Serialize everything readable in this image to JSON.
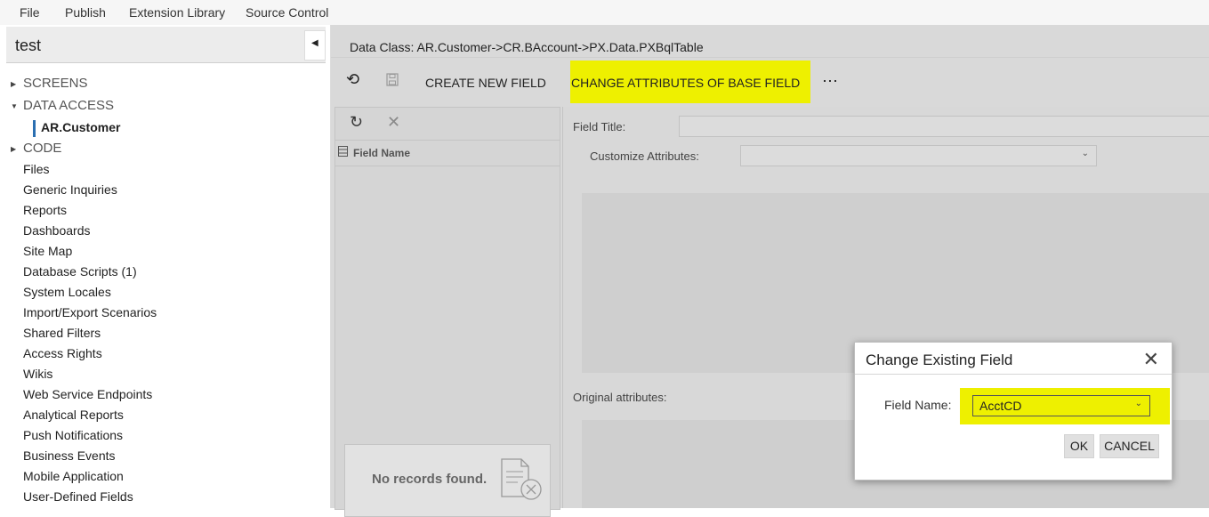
{
  "menu": {
    "items": [
      "File",
      "Publish",
      "Extension Library",
      "Source Control"
    ]
  },
  "project": {
    "title": "test"
  },
  "tree": {
    "screens_label": "SCREENS",
    "data_access_label": "DATA ACCESS",
    "selected_item": "AR.Customer",
    "code_label": "CODE",
    "leaves": [
      "Files",
      "Generic Inquiries",
      "Reports",
      "Dashboards",
      "Site Map",
      "Database Scripts (1)",
      "System Locales",
      "Import/Export Scenarios",
      "Shared Filters",
      "Access Rights",
      "Wikis",
      "Web Service Endpoints",
      "Analytical Reports",
      "Push Notifications",
      "Business Events",
      "Mobile Application",
      "User-Defined Fields"
    ]
  },
  "main": {
    "data_class": "Data Class: AR.Customer->CR.BAccount->PX.Data.PXBqlTable",
    "create_new_field": "CREATE NEW FIELD",
    "change_attributes": "CHANGE ATTRIBUTES OF BASE FIELD",
    "more": "⋯",
    "grid_header": "Field Name",
    "no_records": "No records found.",
    "field_title_label": "Field Title:",
    "customize_attributes_label": "Customize Attributes:",
    "original_attributes_label": "Original attributes:"
  },
  "dialog": {
    "title": "Change Existing Field",
    "field_label": "Field Name:",
    "field_value": "AcctCD",
    "ok": "OK",
    "cancel": "CANCEL"
  },
  "colors": {
    "highlight": "#eef000",
    "selection": "#2b6fb1"
  }
}
